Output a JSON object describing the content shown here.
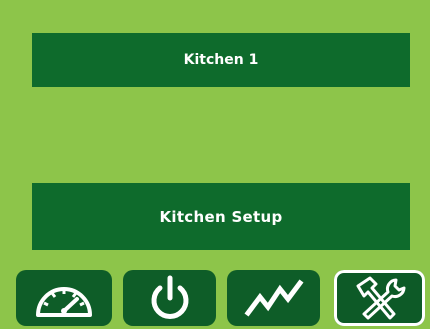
{
  "main": {
    "kitchen_name": "Kitchen 1",
    "setup_label": "Kitchen Setup"
  },
  "nav": {
    "items": [
      {
        "icon": "gauge-icon",
        "active": false
      },
      {
        "icon": "power-icon",
        "active": false
      },
      {
        "icon": "chart-icon",
        "active": false
      },
      {
        "icon": "tools-icon",
        "active": true
      }
    ]
  },
  "colors": {
    "background": "#8dc54a",
    "button": "#0e6b2c",
    "nav_button": "#0e5d28",
    "text": "#ffffff"
  }
}
